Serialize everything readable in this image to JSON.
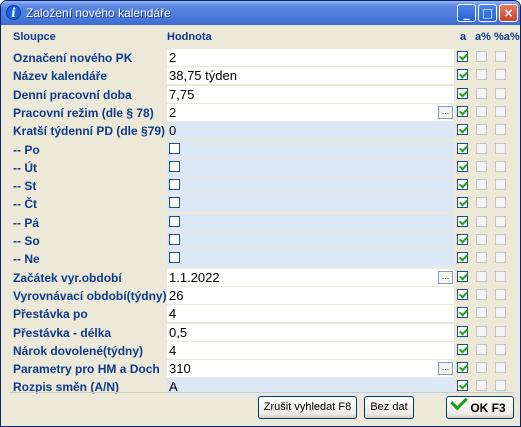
{
  "window": {
    "title": "Založení nového kalendáře",
    "icon": "info-icon"
  },
  "title_buttons": {
    "minimize": "_",
    "maximize": "□",
    "close": "×"
  },
  "columns": {
    "name": "Sloupce",
    "value": "Hodnota",
    "a": "a",
    "a_pct": "a%",
    "pct_a_pct": "%a%"
  },
  "rows": [
    {
      "label": "Označení nového PK",
      "value": "2",
      "a_checked": true,
      "picker": false
    },
    {
      "label": "Název kalendáře",
      "value": "38,75 týden",
      "a_checked": true,
      "picker": false
    },
    {
      "label": "Denní pracovní doba",
      "value": "7,75",
      "a_checked": true,
      "picker": false
    },
    {
      "label": "Pracovní režim (dle § 78)",
      "value": "2",
      "a_checked": true,
      "picker": true
    },
    {
      "label": "Kratší týdenní PD (dle §79)",
      "value": "0",
      "a_checked": true,
      "picker": false
    },
    {
      "label": "-- Po",
      "value": "",
      "checkbox": true,
      "a_checked": true,
      "picker": false
    },
    {
      "label": "-- Út",
      "value": "",
      "checkbox": true,
      "a_checked": true,
      "picker": false
    },
    {
      "label": "-- St",
      "value": "",
      "checkbox": true,
      "a_checked": true,
      "picker": false
    },
    {
      "label": "-- Čt",
      "value": "",
      "checkbox": true,
      "a_checked": true,
      "picker": false
    },
    {
      "label": "-- Pá",
      "value": "",
      "checkbox": true,
      "a_checked": true,
      "picker": false
    },
    {
      "label": "-- So",
      "value": "",
      "checkbox": true,
      "a_checked": true,
      "picker": false
    },
    {
      "label": "-- Ne",
      "value": "",
      "checkbox": true,
      "a_checked": true,
      "picker": false
    },
    {
      "label": "Začátek vyr.období",
      "value": "1.1.2022",
      "a_checked": true,
      "picker": true
    },
    {
      "label": "Vyrovnávací období(týdny)",
      "value": "26",
      "a_checked": true,
      "picker": false
    },
    {
      "label": "Přestávka po",
      "value": "4",
      "a_checked": true,
      "picker": false
    },
    {
      "label": "Přestávka - délka",
      "value": "0,5",
      "a_checked": true,
      "picker": false
    },
    {
      "label": "Nárok dovolené(týdny)",
      "value": "4",
      "a_checked": true,
      "picker": false
    },
    {
      "label": "Parametry pro HM a Doch",
      "value": "310",
      "a_checked": true,
      "picker": true
    },
    {
      "label": "Rozpis směn (A/N)",
      "value": "A",
      "a_checked": true,
      "picker": false
    }
  ],
  "picker_label": "...",
  "buttons": {
    "cancel_search": "Zrušit vyhledat F8",
    "no_date": "Bez dat",
    "ok": "OK F3"
  },
  "colors": {
    "label": "#0d3b8a",
    "value_alt_bg": "#dde8f7",
    "check": "#21a121"
  }
}
